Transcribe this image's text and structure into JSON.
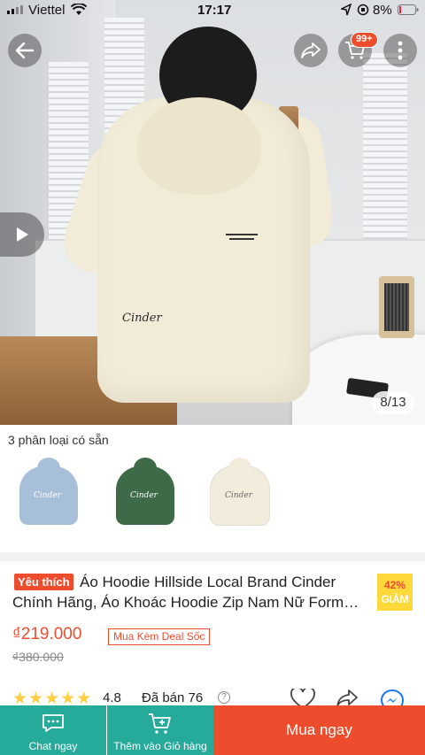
{
  "status_bar": {
    "carrier": "Viettel",
    "time": "17:17",
    "battery": "8%"
  },
  "header": {
    "cart_badge": "99+"
  },
  "gallery": {
    "counter": "8/13",
    "print_text": "Cinder"
  },
  "variants": {
    "count_label": "3 phân loại có sẵn",
    "items": [
      {
        "color": "#a7bfd9",
        "print": "Cinder"
      },
      {
        "color": "#3e6a47",
        "print": "Cinder"
      },
      {
        "color": "#f2ecdd",
        "print": "Cinder"
      }
    ]
  },
  "product": {
    "tag": "Yêu thích",
    "title": "Áo Hoodie Hillside Local Brand Cinder Chính Hãng, Áo Khoác Hoodie Zip Nam Nữ Form Rộng",
    "discount_pct": "42%",
    "discount_label": "GIẢM",
    "price": "₫219.000",
    "deal_label": "Mua Kèm Deal Sốc",
    "original_price": "₫380.000",
    "rating": "4.8",
    "stars": 4.8,
    "sold": "Đã bán 76"
  },
  "bottom_bar": {
    "chat_label": "Chat ngay",
    "add_cart_label": "Thêm vào Giỏ hàng",
    "buy_label": "Mua ngay"
  },
  "colors": {
    "accent": "#ee4d2d",
    "teal": "#26aa99",
    "star": "#ffce3d"
  }
}
